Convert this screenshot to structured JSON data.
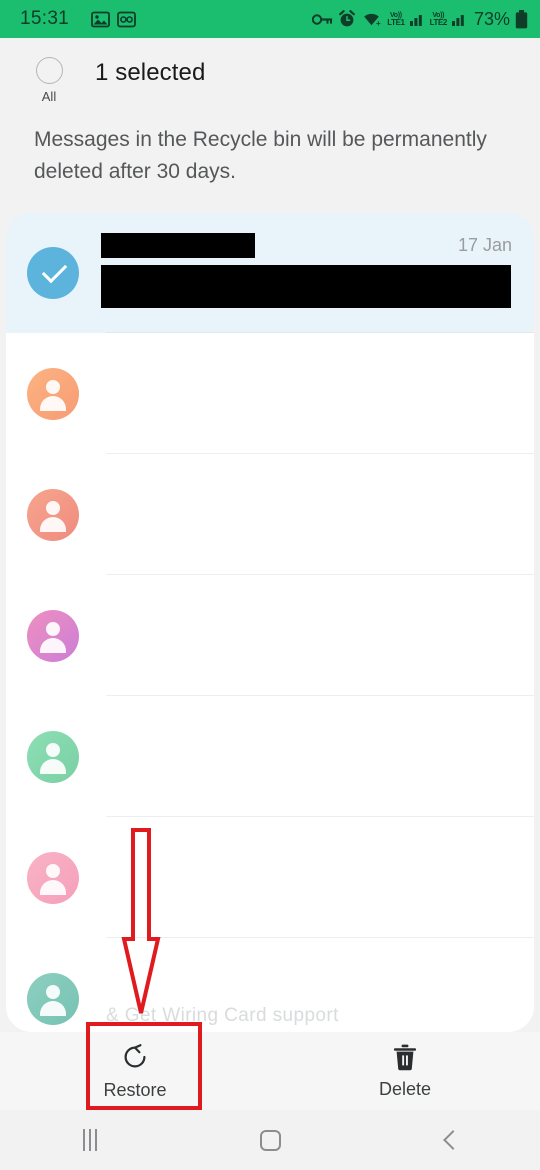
{
  "status_bar": {
    "clock": "15:31",
    "battery_percent": "73%",
    "left_icons": [
      "image-icon",
      "screen-recorder-icon"
    ],
    "right_icons": [
      "key-icon",
      "alarm-icon",
      "wifi-icon",
      "volte1-signal-icon",
      "volte2-signal-icon",
      "battery-icon"
    ],
    "sim1_label_top": "Vo))",
    "sim1_label_bottom": "LTE1",
    "sim2_label_top": "Vo))",
    "sim2_label_bottom": "LTE2",
    "background_color": "#1bbd6e"
  },
  "selection_header": {
    "select_all_label": "All",
    "selected_count_text": "1 selected",
    "select_all_checked": false
  },
  "info_notice": {
    "text": "Messages in the Recycle bin will be permanently deleted after 30 days."
  },
  "message_list": {
    "rows": [
      {
        "id": "row-1",
        "selected": true,
        "avatar_color": "#5cb4dd",
        "avatar_type": "checked",
        "name_redacted": true,
        "body_redacted": true,
        "date": "17 Jan"
      },
      {
        "id": "row-2",
        "selected": false,
        "avatar_color_start": "#fcb382",
        "avatar_color_end": "#f79b74",
        "avatar_type": "person",
        "name_redacted": false,
        "body_redacted": false,
        "date": ""
      },
      {
        "id": "row-3",
        "selected": false,
        "avatar_color_start": "#f7a58f",
        "avatar_color_end": "#ef8b7e",
        "avatar_type": "person",
        "name_redacted": false,
        "body_redacted": false,
        "date": ""
      },
      {
        "id": "row-4",
        "selected": false,
        "avatar_color_start": "#ef8fc0",
        "avatar_color_end": "#cb7ed6",
        "avatar_type": "person",
        "name_redacted": false,
        "body_redacted": false,
        "date": ""
      },
      {
        "id": "row-5",
        "selected": false,
        "avatar_color_start": "#8ddfb4",
        "avatar_color_end": "#7acfa4",
        "avatar_type": "person",
        "name_redacted": false,
        "body_redacted": false,
        "date": ""
      },
      {
        "id": "row-6",
        "selected": false,
        "avatar_color_start": "#f9b3c6",
        "avatar_color_end": "#f4a0ba",
        "avatar_type": "person",
        "name_redacted": false,
        "body_redacted": false,
        "date": ""
      },
      {
        "id": "row-7",
        "selected": false,
        "avatar_color_start": "#8dcfc0",
        "avatar_color_end": "#77c2b3",
        "avatar_type": "person",
        "name_redacted": false,
        "body_redacted": false,
        "date": ""
      }
    ],
    "partial_last_row_text": "& Get Wiring Card  support"
  },
  "action_bar": {
    "restore_label": "Restore",
    "delete_label": "Delete"
  },
  "navigation_bar": {
    "recents_label": "Recents",
    "home_label": "Home",
    "back_label": "Back"
  },
  "annotations": {
    "arrow_color": "#e01b20",
    "highlight_rect_color": "#e01b20",
    "highlight_target": "Restore"
  }
}
